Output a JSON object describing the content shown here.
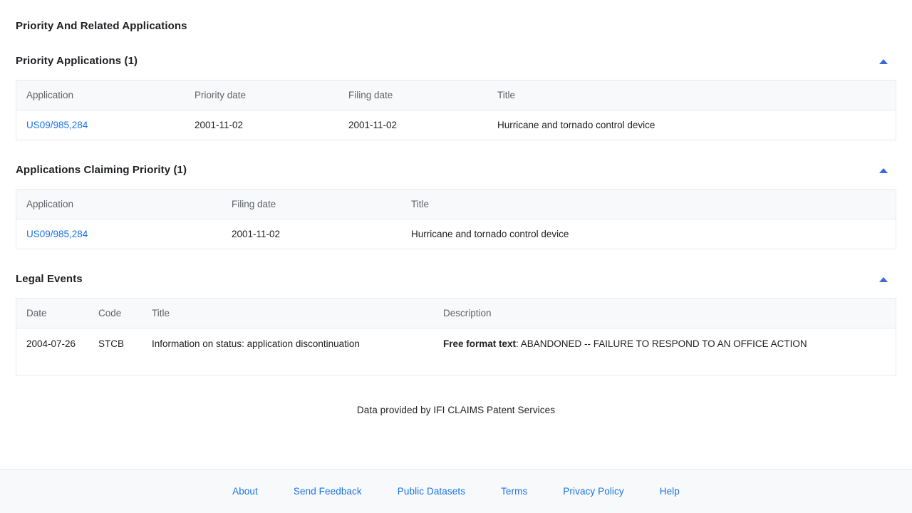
{
  "page_title": "Priority And Related Applications",
  "accent_color": "#1a73e8",
  "collapse_icon_color": "#3b68d8",
  "sections": [
    {
      "title": "Priority Applications (1)",
      "collapse_icon": "triangle-up-icon",
      "columns": [
        "Application",
        "Priority date",
        "Filing date",
        "Title"
      ],
      "rows": [
        {
          "application": "US09/985,284",
          "priority_date": "2001-11-02",
          "filing_date": "2001-11-02",
          "title": "Hurricane and tornado control device"
        }
      ]
    },
    {
      "title": "Applications Claiming Priority (1)",
      "collapse_icon": "triangle-up-icon",
      "columns": [
        "Application",
        "Filing date",
        "Title"
      ],
      "rows": [
        {
          "application": "US09/985,284",
          "filing_date": "2001-11-02",
          "title": "Hurricane and tornado control device"
        }
      ]
    },
    {
      "title": "Legal Events",
      "collapse_icon": "triangle-up-icon",
      "columns": [
        "Date",
        "Code",
        "Title",
        "Description"
      ],
      "rows": [
        {
          "date": "2004-07-26",
          "code": "STCB",
          "title": "Information on status: application discontinuation",
          "description_label": "Free format text",
          "description_text": ": ABANDONED -- FAILURE TO RESPOND TO AN OFFICE ACTION"
        }
      ]
    }
  ],
  "attribution": "Data provided by IFI CLAIMS Patent Services",
  "footer": {
    "links": [
      "About",
      "Send Feedback",
      "Public Datasets",
      "Terms",
      "Privacy Policy",
      "Help"
    ]
  }
}
